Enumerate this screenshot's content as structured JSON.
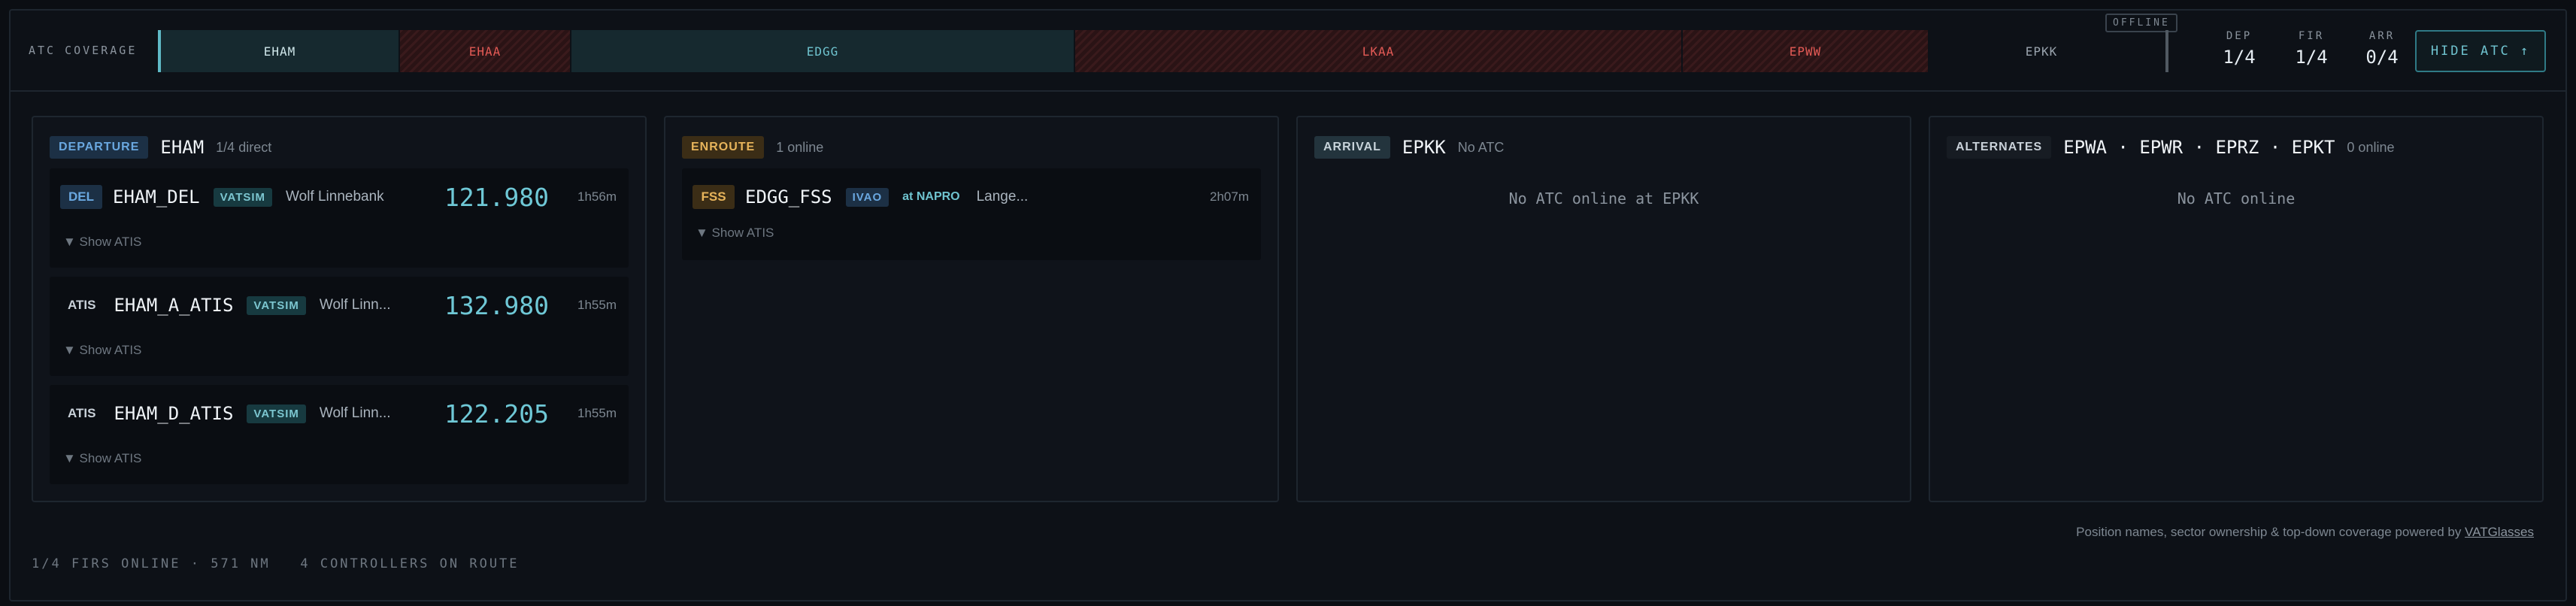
{
  "coverage": {
    "label": "ATC COVERAGE",
    "segments": [
      {
        "icao": "EHAM",
        "status": "online"
      },
      {
        "icao": "EHAA",
        "status": "offline"
      },
      {
        "icao": "EDGG",
        "status": "online"
      },
      {
        "icao": "LKAA",
        "status": "offline"
      },
      {
        "icao": "EPWW",
        "status": "offline"
      },
      {
        "icao": "EPKK",
        "status": "none"
      }
    ],
    "offline_tag": "OFFLINE"
  },
  "stats": {
    "dep": {
      "label": "DEP",
      "value": "1/4"
    },
    "fir": {
      "label": "FIR",
      "value": "1/4"
    },
    "arr": {
      "label": "ARR",
      "value": "0/4"
    }
  },
  "hide_atc_label": "HIDE ATC ↑",
  "panels": {
    "departure": {
      "tag": "DEPARTURE",
      "icao": "EHAM",
      "sub": "1/4 direct",
      "controllers": [
        {
          "position": "DEL",
          "callsign": "EHAM_DEL",
          "network": "VATSIM",
          "name": "Wolf Linnebank",
          "freq": "121.980",
          "duration": "1h56m",
          "show_atis": "▼ Show ATIS"
        },
        {
          "position": "ATIS",
          "callsign": "EHAM_A_ATIS",
          "network": "VATSIM",
          "name": "Wolf Linn...",
          "freq": "132.980",
          "duration": "1h55m",
          "show_atis": "▼ Show ATIS"
        },
        {
          "position": "ATIS",
          "callsign": "EHAM_D_ATIS",
          "network": "VATSIM",
          "name": "Wolf Linn...",
          "freq": "122.205",
          "duration": "1h55m",
          "show_atis": "▼ Show ATIS"
        }
      ]
    },
    "enroute": {
      "tag": "ENROUTE",
      "sub": "1 online",
      "controllers": [
        {
          "position": "FSS",
          "callsign": "EDGG_FSS",
          "network": "IVAO",
          "at": "at NAPRO",
          "name": "Lange...",
          "duration": "2h07m",
          "show_atis": "▼ Show ATIS"
        }
      ]
    },
    "arrival": {
      "tag": "ARRIVAL",
      "icao": "EPKK",
      "sub": "No ATC",
      "empty": "No ATC online at EPKK"
    },
    "alternates": {
      "tag": "ALTERNATES",
      "icaos": "EPWA · EPWR · EPRZ · EPKT",
      "sub": "0 online",
      "empty": "No ATC online"
    }
  },
  "credit": {
    "text": "Position names, sector ownership & top-down coverage powered by ",
    "link": "VATGlasses"
  },
  "footer": {
    "firs": "1/4 FIRS ONLINE · 571 NM",
    "controllers": "4 CONTROLLERS ON ROUTE"
  },
  "colors": {
    "online_fill": "#16292f",
    "offline_text": "#e35a55",
    "accent": "#6fc3cf",
    "departure": "#6aa8e0",
    "enroute": "#e7b45b"
  }
}
